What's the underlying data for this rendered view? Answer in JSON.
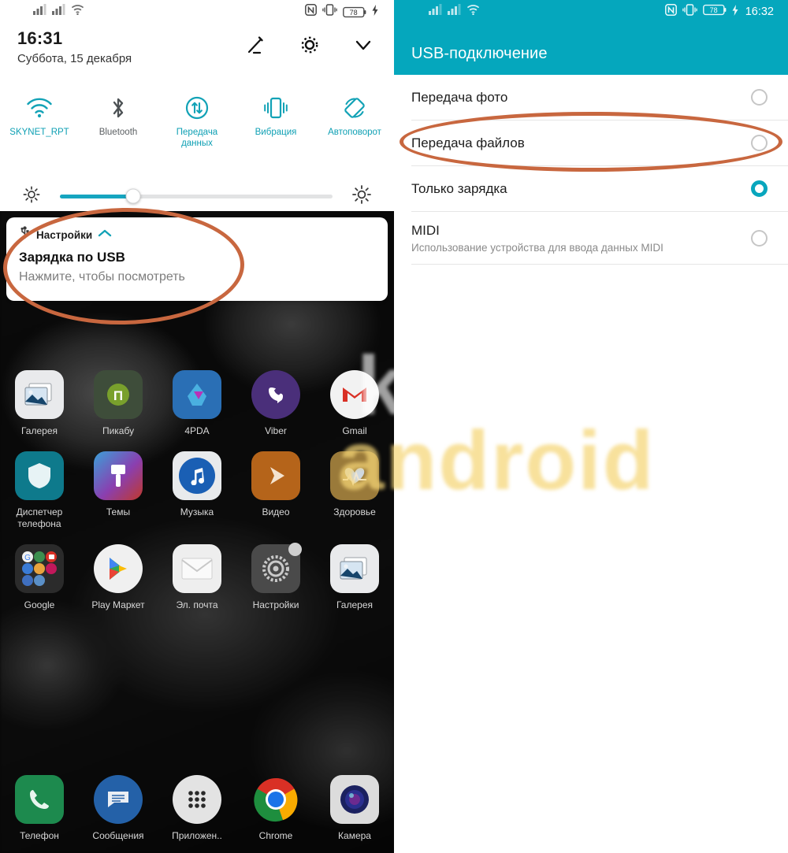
{
  "left_panel": {
    "status_bar": {
      "signal1_icon": "signal-bars-icon",
      "signal2_icon": "signal-bars-icon",
      "wifi_icon": "wifi-icon",
      "nfc_icon": "nfc-icon",
      "vibrate_icon": "vibrate-icon",
      "battery_level": "78",
      "charging_icon": "charging-bolt-icon"
    },
    "clock": {
      "time": "16:31",
      "date": "Суббота, 15 декабря"
    },
    "header_actions": [
      {
        "name": "edit-button",
        "icon": "pencil-icon"
      },
      {
        "name": "settings-button",
        "icon": "gear-icon"
      },
      {
        "name": "expand-button",
        "icon": "chevron-down-icon"
      }
    ],
    "quick_toggles": [
      {
        "label": "SKYNET_RPT",
        "icon": "wifi-icon",
        "active": true
      },
      {
        "label": "Bluetooth",
        "icon": "bluetooth-icon",
        "active": false
      },
      {
        "label": "Передача данных",
        "icon": "data-transfer-icon",
        "active": true
      },
      {
        "label": "Вибрация",
        "icon": "vibrate-icon",
        "active": true
      },
      {
        "label": "Автоповорот",
        "icon": "auto-rotate-icon",
        "active": true
      }
    ],
    "brightness": {
      "low_icon": "brightness-low-icon",
      "high_icon": "brightness-high-icon",
      "value_percent": 27
    },
    "notification": {
      "app_icon": "usb-icon",
      "app_name": "Настройки",
      "collapse_icon": "chevron-up-icon",
      "title": "Зарядка по USB",
      "subtitle": "Нажмите, чтобы посмотреть"
    },
    "app_rows": [
      [
        {
          "label": "Галерея",
          "icon": "gallery-icon"
        },
        {
          "label": "Пикабу",
          "icon": "pikabu-icon"
        },
        {
          "label": "4PDA",
          "icon": "fourpda-icon"
        },
        {
          "label": "Viber",
          "icon": "viber-icon"
        },
        {
          "label": "Gmail",
          "icon": "gmail-icon"
        }
      ],
      [
        {
          "label": "Диспетчер телефона",
          "icon": "shield-icon"
        },
        {
          "label": "Темы",
          "icon": "themes-brush-icon"
        },
        {
          "label": "Музыка",
          "icon": "music-note-icon"
        },
        {
          "label": "Видео",
          "icon": "video-play-icon"
        },
        {
          "label": "Здоровье",
          "icon": "health-heart-icon"
        }
      ],
      [
        {
          "label": "Google",
          "icon": "google-folder-icon"
        },
        {
          "label": "Play Маркет",
          "icon": "play-store-icon"
        },
        {
          "label": "Эл. почта",
          "icon": "email-envelope-icon"
        },
        {
          "label": "Настройки",
          "icon": "gear-icon"
        },
        {
          "label": "Галерея",
          "icon": "gallery-icon"
        }
      ]
    ],
    "dock": [
      {
        "label": "Телефон",
        "icon": "phone-icon"
      },
      {
        "label": "Сообщения",
        "icon": "messages-icon"
      },
      {
        "label": "Приложен..",
        "icon": "app-drawer-icon"
      },
      {
        "label": "Chrome",
        "icon": "chrome-icon"
      },
      {
        "label": "Камера",
        "icon": "camera-icon"
      }
    ]
  },
  "right_panel": {
    "status_bar": {
      "nfc_icon": "nfc-icon",
      "vibrate_icon": "vibrate-icon",
      "battery_level": "78",
      "charging_icon": "charging-bolt-icon",
      "time": "16:32"
    },
    "title": "USB-подключение",
    "options": [
      {
        "label": "Передача фото",
        "desc": "",
        "selected": false
      },
      {
        "label": "Передача файлов",
        "desc": "",
        "selected": false
      },
      {
        "label": "Только зарядка",
        "desc": "",
        "selected": true
      },
      {
        "label": "MIDI",
        "desc": "Использование устройства для ввода данных MIDI",
        "selected": false
      }
    ]
  },
  "annotations": [
    {
      "name": "highlight-usb-notification",
      "shape": "ellipse",
      "color": "#c8673f"
    },
    {
      "name": "highlight-file-transfer-option",
      "shape": "ellipse",
      "color": "#c8673f"
    }
  ],
  "watermark": {
    "line1": "kak na",
    "line2": "android"
  },
  "colors": {
    "accent_teal": "#05a7bd",
    "toggle_active": "#0fa0b4",
    "annotation_orange": "#c8673f"
  }
}
